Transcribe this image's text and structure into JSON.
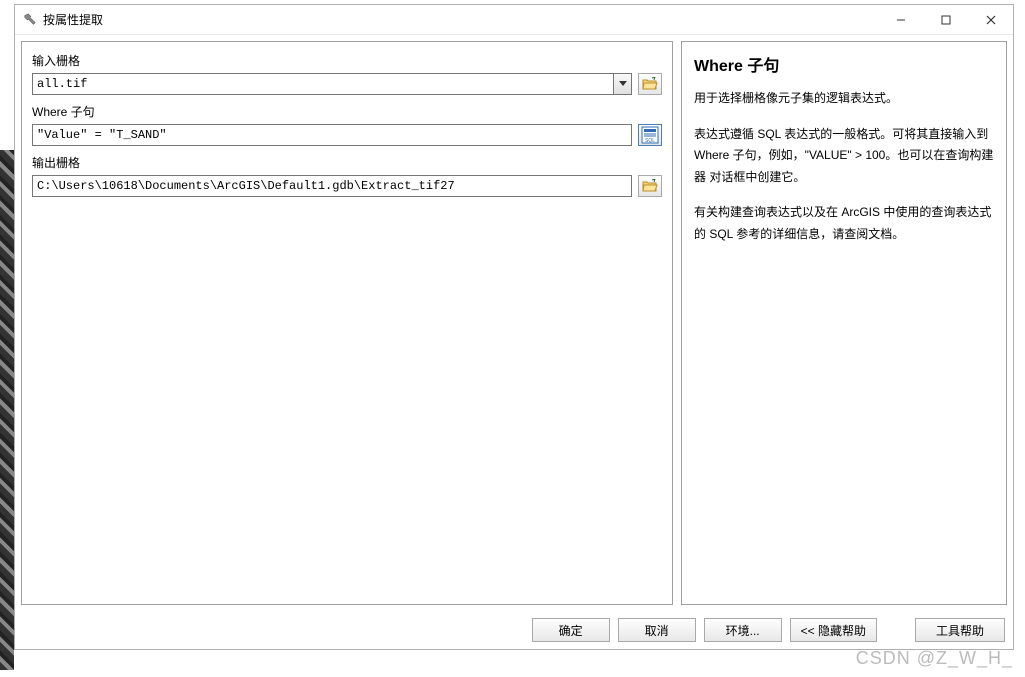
{
  "window": {
    "title": "按属性提取"
  },
  "form": {
    "input_raster_label": "输入栅格",
    "input_raster_value": "all.tif",
    "where_label": "Where 子句",
    "where_value": "\"Value\" = \"T_SAND\"",
    "output_raster_label": "输出栅格",
    "output_raster_value": "C:\\Users\\10618\\Documents\\ArcGIS\\Default1.gdb\\Extract_tif27"
  },
  "help": {
    "title": "Where 子句",
    "p1": "用于选择栅格像元子集的逻辑表达式。",
    "p2": "表达式遵循 SQL 表达式的一般格式。可将其直接输入到 Where 子句，例如，\"VALUE\" > 100。也可以在查询构建器 对话框中创建它。",
    "p3": "有关构建查询表达式以及在 ArcGIS 中使用的查询表达式的 SQL 参考的详细信息，请查阅文档。"
  },
  "buttons": {
    "ok": "确定",
    "cancel": "取消",
    "environments": "环境...",
    "hide_help": "<< 隐藏帮助",
    "tool_help": "工具帮助"
  },
  "watermark": "CSDN @Z_W_H_"
}
